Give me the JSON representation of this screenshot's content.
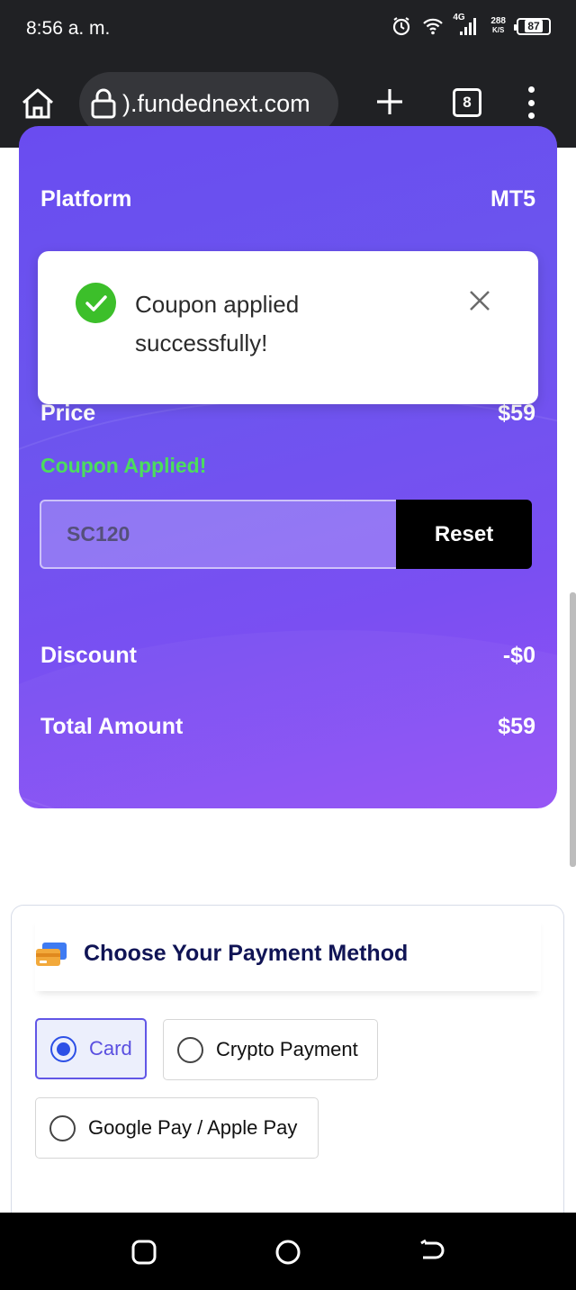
{
  "status_bar": {
    "time": "8:56 a. m.",
    "network": "4G",
    "speed_value": "288",
    "speed_unit": "K/S",
    "battery": "87"
  },
  "browser": {
    "url": ").fundednext.com",
    "tab_count": "8",
    "icons": [
      "home-icon",
      "lock-icon",
      "plus-icon",
      "tabs-icon",
      "more-vert-icon"
    ]
  },
  "summary": {
    "platform_label": "Platform",
    "platform_value": "MT5",
    "price_label": "Price",
    "price_value": "$59",
    "coupon_status": "Coupon Applied!",
    "coupon_code": "SC120",
    "reset_label": "Reset",
    "discount_label": "Discount",
    "discount_value": "-$0",
    "total_label": "Total Amount",
    "total_value": "$59"
  },
  "toast": {
    "message": "Coupon applied successfully!",
    "icon": "check-circle-icon",
    "close_icon": "close-icon"
  },
  "payment": {
    "title": "Choose Your Payment Method",
    "icon": "credit-card-icon",
    "options": [
      {
        "label": "Card",
        "selected": true
      },
      {
        "label": "Crypto Payment",
        "selected": false
      },
      {
        "label": "Google Pay / Apple Pay",
        "selected": false
      }
    ]
  },
  "colors": {
    "card_gradient_start": "#6a4cf0",
    "card_gradient_end": "#9350f5",
    "success_green": "#4cdc5e",
    "selected_blue": "#2d50e6",
    "title_navy": "#101455"
  }
}
